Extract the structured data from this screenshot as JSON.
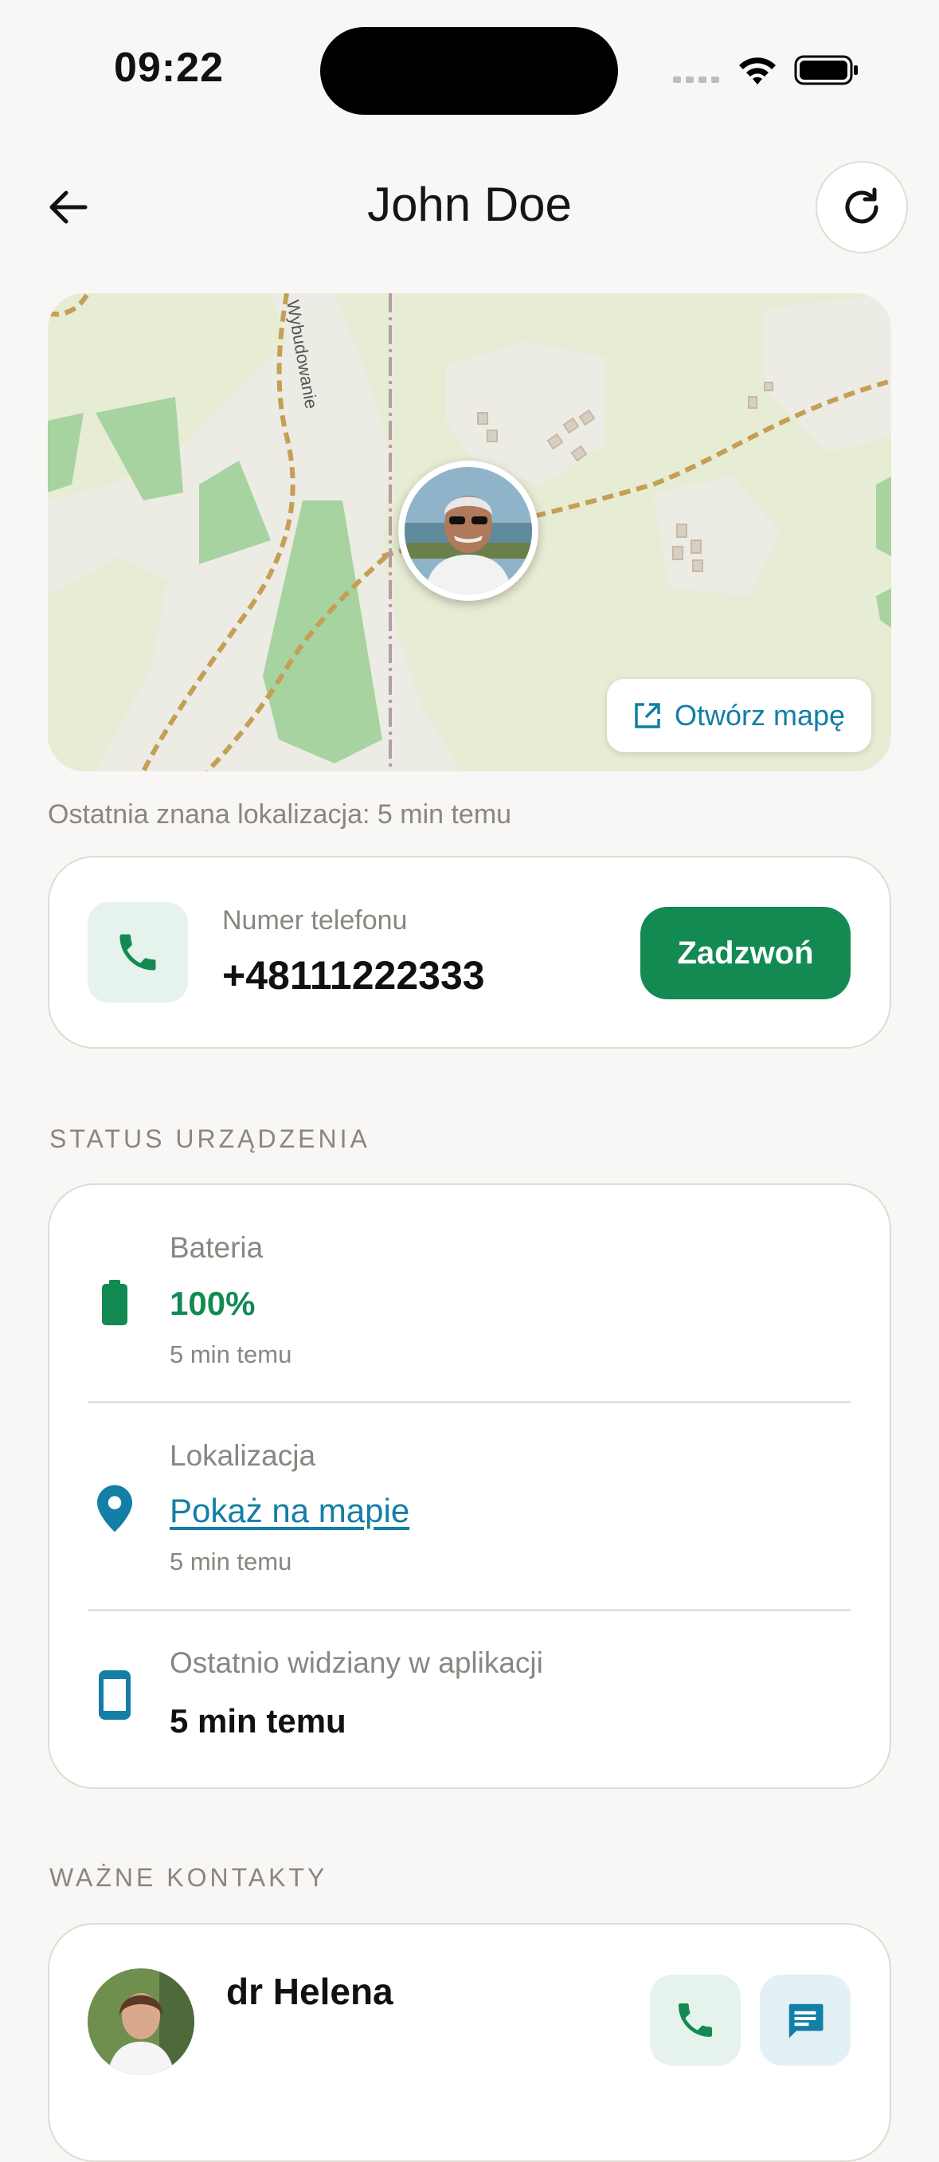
{
  "status_bar": {
    "time": "09:22",
    "icons": [
      "signal-icon",
      "wifi-icon",
      "battery-icon"
    ]
  },
  "header": {
    "title": "John Doe",
    "back_icon": "arrow-left-icon",
    "refresh_icon": "refresh-icon"
  },
  "map": {
    "street_label": "Wybudowanie",
    "open_map_label": "Otwórz mapę",
    "open_map_icon": "external-link-icon",
    "last_location": "Ostatnia znana lokalizacja: 5 min temu"
  },
  "phone": {
    "label": "Numer telefonu",
    "number": "+48111222333",
    "call_label": "Zadzwoń",
    "icon": "phone-icon"
  },
  "device_status": {
    "section_title": "STATUS URZĄDZENIA",
    "battery": {
      "label": "Bateria",
      "value": "100%",
      "time": "5 min temu",
      "icon": "battery-icon"
    },
    "location": {
      "label": "Lokalizacja",
      "value": "Pokaż na mapie",
      "time": "5 min temu",
      "icon": "location-pin-icon"
    },
    "last_seen": {
      "label": "Ostatnio widziany w aplikacji",
      "value": "5 min temu",
      "icon": "smartphone-icon"
    }
  },
  "contacts": {
    "section_title": "WAŻNE KONTAKTY",
    "items": [
      {
        "name": "dr Helena",
        "call_icon": "phone-icon",
        "message_icon": "message-icon"
      }
    ]
  },
  "colors": {
    "background": "#f8f7f5",
    "accent_green": "#138a52",
    "accent_blue": "#137ea6",
    "muted_text": "#8a8680"
  }
}
